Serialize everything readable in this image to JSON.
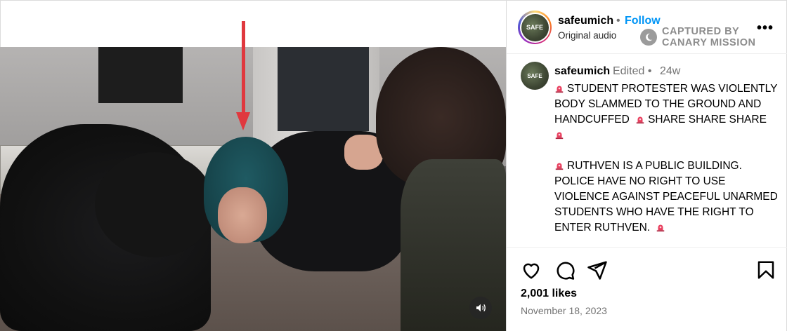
{
  "post": {
    "username": "safeumich",
    "follow_label": "Follow",
    "dot": "•",
    "audio": "Original audio",
    "more_label": "•••",
    "avatar_text": "SAFE"
  },
  "watermark": {
    "line1": "CAPTURED BY",
    "line2": "CANARY MISSION",
    "icon": "moon-icon"
  },
  "caption": {
    "username": "safeumich",
    "edited": "Edited •",
    "time": "24w",
    "paragraphs": [
      {
        "emoji_before": true,
        "text": "STUDENT PROTESTER WAS VIOLENTLY BODY SLAMMED TO THE GROUND AND HANDCUFFED",
        "emoji_mid": true,
        "text2": "SHARE SHARE SHARE",
        "emoji_after_line": true
      },
      {
        "emoji_before": true,
        "text": "RUTHVEN IS A PUBLIC BUILDING. POLICE HAVE NO RIGHT TO USE VIOLENCE AGAINST PEACEFUL UNARMED STUDENTS WHO HAVE THE RIGHT TO ENTER RUTHVEN.",
        "emoji_end": true
      }
    ],
    "siren_color": "#e8405f"
  },
  "stats": {
    "likes": "2,001 likes",
    "date": "November 18, 2023"
  },
  "actions": [
    "heart-icon",
    "comment-icon",
    "share-icon",
    "bookmark-icon"
  ],
  "colors": {
    "follow": "#0095f6",
    "annotation_arrow": "#e0383e",
    "muted_text": "#737373"
  }
}
